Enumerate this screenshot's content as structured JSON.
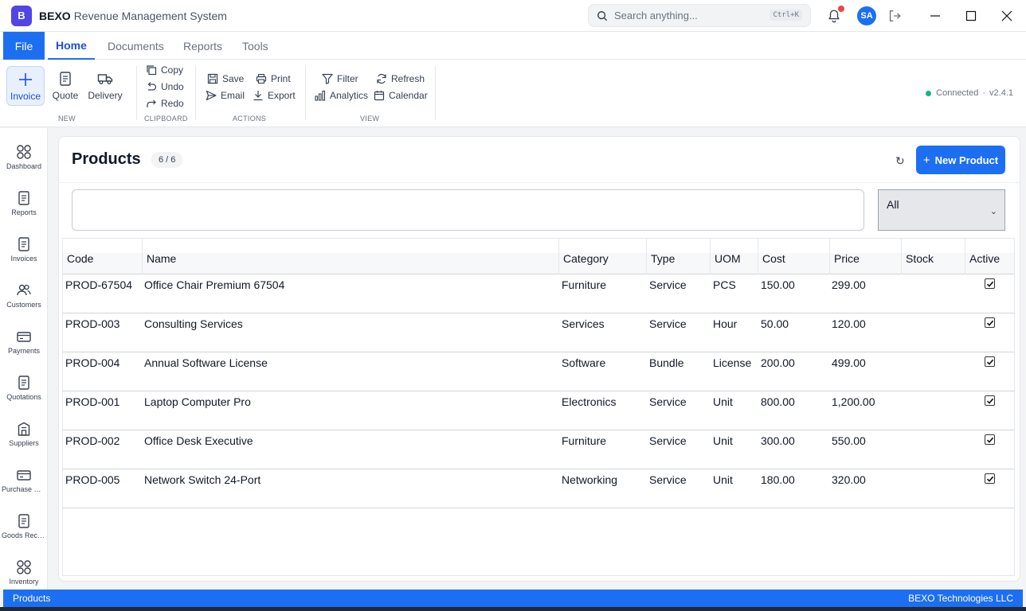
{
  "app": {
    "logo_letter": "B",
    "brand": "BEXO",
    "subtitle": "Revenue Management System"
  },
  "search": {
    "placeholder": "Search anything...",
    "shortcut": "Ctrl+K"
  },
  "user": {
    "initials": "SA"
  },
  "menu": {
    "file": "File",
    "tabs": [
      "Home",
      "Documents",
      "Reports",
      "Tools"
    ],
    "active_tab": "Home"
  },
  "ribbon": {
    "new": {
      "label": "NEW",
      "invoice": "Invoice",
      "quote": "Quote",
      "delivery": "Delivery"
    },
    "clipboard": {
      "label": "CLIPBOARD",
      "copy": "Copy",
      "undo": "Undo",
      "redo": "Redo"
    },
    "actions": {
      "label": "ACTIONS",
      "save": "Save",
      "print": "Print",
      "email": "Email",
      "export": "Export"
    },
    "view": {
      "label": "VIEW",
      "filter": "Filter",
      "refresh": "Refresh",
      "analytics": "Analytics",
      "calendar": "Calendar"
    },
    "status": {
      "text": "Connected",
      "sep": "·",
      "version": "v2.4.1"
    }
  },
  "sidebar": {
    "items": [
      {
        "label": "Dashboard",
        "icon": "grid-icon"
      },
      {
        "label": "Reports",
        "icon": "document-icon"
      },
      {
        "label": "Invoices",
        "icon": "document-icon"
      },
      {
        "label": "Customers",
        "icon": "users-icon"
      },
      {
        "label": "Payments",
        "icon": "card-icon"
      },
      {
        "label": "Quotations",
        "icon": "document-icon"
      },
      {
        "label": "Suppliers",
        "icon": "building-icon"
      },
      {
        "label": "Purchase Orders",
        "icon": "card-icon"
      },
      {
        "label": "Goods Received",
        "icon": "document-icon"
      },
      {
        "label": "Inventory",
        "icon": "grid-icon"
      }
    ]
  },
  "page": {
    "title": "Products",
    "count": "6 / 6",
    "refresh_glyph": "↻",
    "new_button_plus": "+",
    "new_button": "New Product",
    "filter_value": "",
    "select_value": "All",
    "select_chevron": "⌄"
  },
  "table": {
    "columns": [
      "Code",
      "Name",
      "Category",
      "Type",
      "UOM",
      "Cost",
      "Price",
      "Stock",
      "Active"
    ],
    "rows": [
      {
        "code": "PROD-67504",
        "name": "Office Chair Premium 67504",
        "category": "Furniture",
        "type": "Service",
        "uom": "PCS",
        "cost": "150.00",
        "price": "299.00",
        "stock": "",
        "active": true
      },
      {
        "code": "PROD-003",
        "name": "Consulting Services",
        "category": "Services",
        "type": "Service",
        "uom": "Hour",
        "cost": "50.00",
        "price": "120.00",
        "stock": "",
        "active": true
      },
      {
        "code": "PROD-004",
        "name": "Annual Software License",
        "category": "Software",
        "type": "Bundle",
        "uom": "License",
        "cost": "200.00",
        "price": "499.00",
        "stock": "",
        "active": true
      },
      {
        "code": "PROD-001",
        "name": "Laptop Computer Pro",
        "category": "Electronics",
        "type": "Service",
        "uom": "Unit",
        "cost": "800.00",
        "price": "1,200.00",
        "stock": "",
        "active": true
      },
      {
        "code": "PROD-002",
        "name": "Office Desk Executive",
        "category": "Furniture",
        "type": "Service",
        "uom": "Unit",
        "cost": "300.00",
        "price": "550.00",
        "stock": "",
        "active": true
      },
      {
        "code": "PROD-005",
        "name": "Network Switch 24-Port",
        "category": "Networking",
        "type": "Service",
        "uom": "Unit",
        "cost": "180.00",
        "price": "320.00",
        "stock": "",
        "active": true
      }
    ]
  },
  "statusbar": {
    "left": "Products",
    "right": "BEXO Technologies LLC"
  },
  "colors": {
    "accent": "#1d6ff2",
    "logo": "#4f46e5",
    "connected": "#10b981",
    "notification": "#ef4444"
  }
}
